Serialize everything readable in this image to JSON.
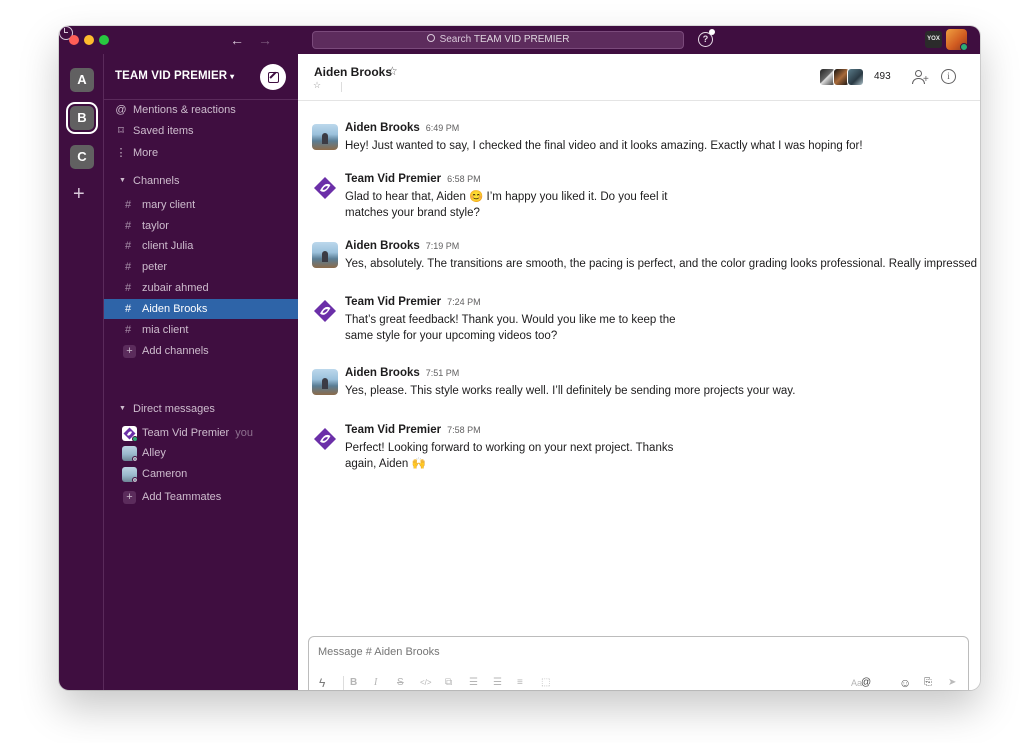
{
  "titlebar": {
    "search_placeholder": "Search",
    "search_team": "TEAM VID PREMIER",
    "help_label": "?",
    "tb_icon_label": "YOX"
  },
  "workspaces": [
    {
      "label": "A"
    },
    {
      "label": "B"
    },
    {
      "label": "C"
    }
  ],
  "sidebar": {
    "team_name": "TEAM VID PREMIER",
    "top_items": [
      {
        "label": "Mentions & reactions",
        "icon": "at-icon"
      },
      {
        "label": "Saved items",
        "icon": "bookmark-icon"
      },
      {
        "label": "More",
        "icon": "more-vertical-icon"
      }
    ],
    "channels_header": "Channels",
    "channels": [
      {
        "label": "mary client"
      },
      {
        "label": "taylor"
      },
      {
        "label": "client Julia"
      },
      {
        "label": "peter"
      },
      {
        "label": "zubair ahmed"
      },
      {
        "label": "Aiden Brooks",
        "active": true
      },
      {
        "label": "mia client"
      }
    ],
    "add_channels": "Add channels",
    "dm_header": "Direct messages",
    "dms": [
      {
        "label": "Team Vid Premier",
        "suffix": "you"
      },
      {
        "label": "Alley"
      },
      {
        "label": "Cameron"
      }
    ],
    "add_teammates": "Add Teammates"
  },
  "channel": {
    "name": "Aiden Brooks",
    "member_count": "493"
  },
  "messages": [
    {
      "author": "Aiden Brooks",
      "time": "6:49 PM",
      "lines": [
        "Hey! Just wanted to say, I checked the final video and it looks amazing. Exactly what I was hoping for!"
      ],
      "avatar": "photo"
    },
    {
      "author": "Team Vid Premier",
      "time": "6:58 PM",
      "lines": [
        "Glad to hear that, Aiden 😊 I’m happy you liked it. Do you feel it",
        "matches your brand style?"
      ],
      "avatar": "brand"
    },
    {
      "author": "Aiden Brooks",
      "time": "7:19 PM",
      "lines": [
        "Yes, absolutely. The transitions are smooth, the pacing is perfect, and the color grading looks professional. Really impressed 👏"
      ],
      "avatar": "photo"
    },
    {
      "author": "Team Vid Premier",
      "time": "7:24 PM",
      "lines": [
        "That’s great feedback! Thank you. Would you like me to keep the",
        "same style for your upcoming videos too?"
      ],
      "avatar": "brand"
    },
    {
      "author": "Aiden Brooks",
      "time": "7:51 PM",
      "lines": [
        "Yes, please. This style works really well. I’ll definitely be sending more projects your way."
      ],
      "avatar": "photo"
    },
    {
      "author": "Team Vid Premier",
      "time": "7:58 PM",
      "lines": [
        "Perfect! Looking forward to working on your next project. Thanks",
        "again, Aiden 🙌"
      ],
      "avatar": "brand"
    }
  ],
  "composer": {
    "placeholder": "Message # Aiden Brooks",
    "toolbar": [
      {
        "glyph": "ϟ",
        "icon": "shortcuts-icon"
      },
      {
        "glyph": "B",
        "icon": "bold-icon"
      },
      {
        "glyph": "I",
        "icon": "italic-icon"
      },
      {
        "glyph": "S",
        "icon": "strikethrough-icon"
      },
      {
        "glyph": "</>",
        "icon": "code-icon"
      },
      {
        "glyph": "⧉",
        "icon": "link-icon"
      },
      {
        "glyph": "☰",
        "icon": "ordered-list-icon"
      },
      {
        "glyph": "☰",
        "icon": "bulleted-list-icon"
      },
      {
        "glyph": "≡",
        "icon": "blockquote-icon"
      },
      {
        "glyph": "⬚",
        "icon": "code-block-icon"
      },
      {
        "glyph": "Aa",
        "icon": "format-icon"
      },
      {
        "glyph": "@",
        "icon": "mention-icon"
      },
      {
        "glyph": "☺",
        "icon": "emoji-icon"
      },
      {
        "glyph": "⎘",
        "icon": "attach-icon"
      },
      {
        "glyph": "➤",
        "icon": "send-icon"
      }
    ]
  },
  "colors": {
    "sidebar_bg": "#3f0e40",
    "active_channel": "#2e64a8",
    "presence_online": "#2bac76"
  }
}
